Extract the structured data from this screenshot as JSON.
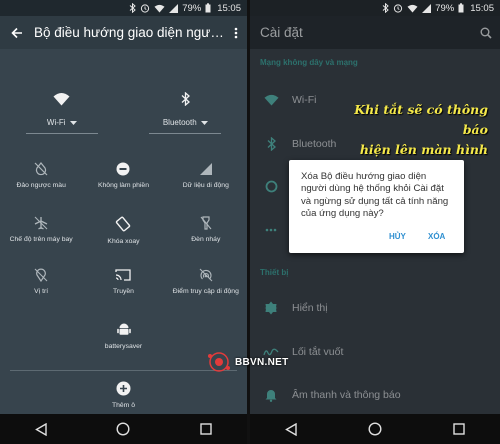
{
  "status_bar": {
    "battery": "79%",
    "time": "15:05"
  },
  "left": {
    "app_title": "Bộ điều hướng giao diện người d...",
    "big_tiles": [
      {
        "label": "Wi-Fi",
        "icon": "wifi-icon"
      },
      {
        "label": "Bluetooth",
        "icon": "bluetooth-icon"
      }
    ],
    "rows": [
      [
        {
          "label": "Đảo ngược màu",
          "icon": "invert-colors-icon"
        },
        {
          "label": "Không làm phiền",
          "icon": "do-not-disturb-icon"
        },
        {
          "label": "Dữ liệu di động",
          "icon": "mobile-data-icon"
        }
      ],
      [
        {
          "label": "Chế độ trên máy bay",
          "icon": "airplane-icon"
        },
        {
          "label": "Khóa xoay",
          "icon": "screen-rotation-icon"
        },
        {
          "label": "Đèn nháy",
          "icon": "flashlight-icon"
        }
      ],
      [
        {
          "label": "Vị trí",
          "icon": "location-icon"
        },
        {
          "label": "Truyền",
          "icon": "cast-icon"
        },
        {
          "label": "Điểm truy cập di động",
          "icon": "hotspot-icon"
        }
      ]
    ],
    "extra_tile": {
      "label": "batterysaver",
      "icon": "android-icon"
    },
    "add_tile": {
      "label": "Thêm ô",
      "icon": "add-icon"
    }
  },
  "right": {
    "app_title": "Cài đặt",
    "section_wireless": "Mạng không dây và mạng",
    "section_device": "Thiết bị",
    "rows": [
      {
        "label": "Wi-Fi",
        "icon": "wifi-icon"
      },
      {
        "label": "Bluetooth",
        "icon": "bluetooth-icon"
      },
      {
        "label": "",
        "icon": "data-usage-icon"
      },
      {
        "label": "",
        "icon": "more-icon"
      },
      {
        "label": "Hiển thị",
        "icon": "brightness-icon"
      },
      {
        "label": "Lối tắt vuốt",
        "icon": "gesture-icon"
      },
      {
        "label": "Âm thanh và thông báo",
        "icon": "bell-icon"
      }
    ],
    "dialog": {
      "message": "Xóa Bộ điều hướng giao diện người dùng hệ thống khỏi Cài đặt và ngừng sử dụng tất cả tính năng của ứng dụng này?",
      "cancel": "HỦY",
      "delete": "XÓA"
    }
  },
  "annotation": {
    "line1": "Khi tắt sẽ có thông báo",
    "line2": "hiện lên màn hình"
  },
  "watermark": {
    "text": "BBVN.NET"
  },
  "colors": {
    "accent": "#2e9b90",
    "dialog_button": "#2f8fd0",
    "annotation": "#f5e94a"
  }
}
